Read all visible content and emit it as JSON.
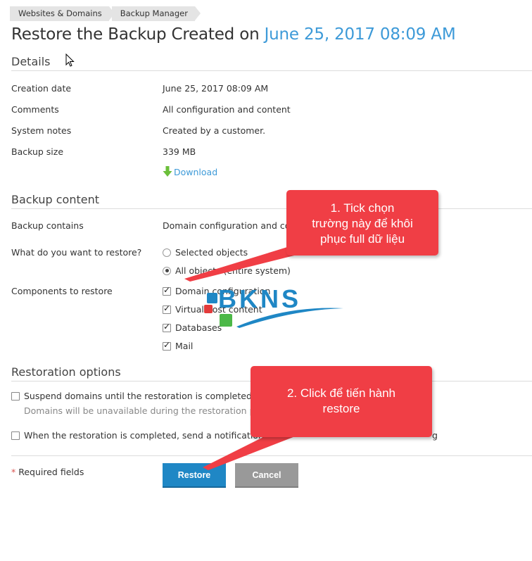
{
  "breadcrumb": [
    "Websites & Domains",
    "Backup Manager"
  ],
  "title": {
    "prefix": "Restore the Backup Created on",
    "date": "June 25, 2017 08:09 AM"
  },
  "details": {
    "heading": "Details",
    "rows": [
      {
        "label": "Creation date",
        "value": "June 25, 2017 08:09 AM"
      },
      {
        "label": "Comments",
        "value": "All configuration and content"
      },
      {
        "label": "System notes",
        "value": "Created by a customer."
      },
      {
        "label": "Backup size",
        "value": "339 MB"
      }
    ],
    "download_label": "Download"
  },
  "backup_content": {
    "heading": "Backup content",
    "contains_label": "Backup contains",
    "contains_value": "Domain configuration and co",
    "restore_label": "What do you want to restore?",
    "restore_options": [
      {
        "label": "Selected objects",
        "checked": false
      },
      {
        "label": "All objects (entire system)",
        "checked": true
      }
    ],
    "components_label": "Components to restore",
    "components": [
      {
        "label": "Domain configuration",
        "checked": true
      },
      {
        "label": "Virtual host content",
        "checked": true
      },
      {
        "label": "Databases",
        "checked": true
      },
      {
        "label": "Mail",
        "checked": true
      }
    ]
  },
  "restoration_options": {
    "heading": "Restoration options",
    "suspend_label": "Suspend domains until the restoration is completed",
    "suspend_hint": "Domains will be unavailable during the restoration pr",
    "notify_label": "When the restoration is completed, send a notification",
    "notify_tail": "g"
  },
  "footer": {
    "required_star": "*",
    "required_label": "Required fields",
    "restore_button": "Restore",
    "cancel_button": "Cancel"
  },
  "callouts": {
    "c1": [
      "1. Tick chọn",
      "trường này để khôi",
      "phục full dữ liệu"
    ],
    "c2": [
      "2. Click để tiến hành",
      "restore"
    ]
  },
  "logo_text": "BKNS",
  "colors": {
    "accent": "#3d9ad8",
    "primary_button": "#1f87c5",
    "callout": "#f03e45",
    "download_icon": "#6bbf3a"
  }
}
